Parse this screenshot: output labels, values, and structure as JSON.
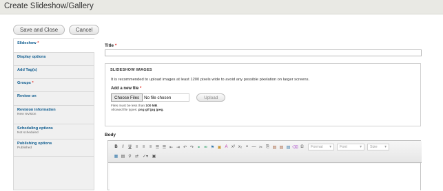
{
  "window": {
    "title": "Create Slideshow/Gallery"
  },
  "actions": {
    "save_close": "Save and Close",
    "cancel": "Cancel"
  },
  "vertical_tabs": [
    {
      "label": "Slideshow",
      "required": "*",
      "sub": ""
    },
    {
      "label": "Display options",
      "required": "",
      "sub": ""
    },
    {
      "label": "Add Tag(s)",
      "required": "",
      "sub": ""
    },
    {
      "label": "Groups",
      "required": "*",
      "sub": ""
    },
    {
      "label": "Review on",
      "required": "",
      "sub": ""
    },
    {
      "label": "Revision information",
      "required": "",
      "sub": "New revision"
    },
    {
      "label": "Scheduling options",
      "required": "",
      "sub": "Not scheduled"
    },
    {
      "label": "Publishing options",
      "required": "",
      "sub": "Published"
    }
  ],
  "title_field": {
    "label": "Title",
    "required": "*",
    "value": ""
  },
  "slideshow_images": {
    "legend": "SLIDESHOW IMAGES",
    "description": "It is recommended to upload images at least 1200 pixels wide to avoid any possible pixelation on larger screens.",
    "add_label": "Add a new file",
    "required": "*",
    "choose_button": "Choose Files",
    "no_file": "No file chosen",
    "upload_button": "Upload",
    "help_size_prefix": "Files must be less than",
    "help_size_value": "100 MB",
    "help_types_prefix": "Allowed file types:",
    "help_types_value": "png gif jpg jpeg"
  },
  "body_field": {
    "label": "Body"
  },
  "editor": {
    "format_combo": "Format",
    "font_combo": "Font",
    "size_combo": "Size"
  }
}
